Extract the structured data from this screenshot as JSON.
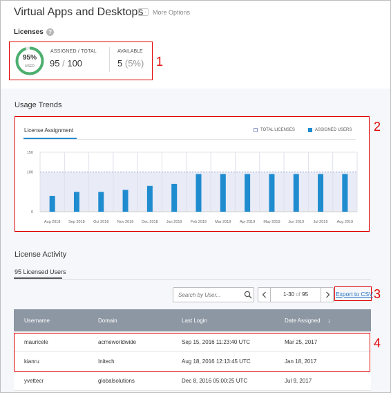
{
  "page": {
    "title": "Virtual Apps and Desktops",
    "more_options": "More Options"
  },
  "licenses": {
    "label": "Licenses",
    "help_icon": "?",
    "percent_used": 95,
    "percent_label": "95%",
    "used_label": "USED",
    "assigned_total_label": "ASSIGNED / TOTAL",
    "assigned": "95",
    "sep": "/",
    "total": "100",
    "available_label": "AVAILABLE",
    "available": "5",
    "available_pct": "(5%)"
  },
  "annotations": {
    "a1": "1",
    "a2": "2",
    "a3": "3",
    "a4": "4",
    "color": "#e00000"
  },
  "usage_trends": {
    "title": "Usage Trends",
    "tab": "License Assignment",
    "legend_total": "TOTAL LICENSES",
    "legend_assigned": "ASSIGNED USERS"
  },
  "chart_data": {
    "type": "bar",
    "title": "",
    "categories": [
      "Aug 2018",
      "Sep 2018",
      "Oct 2018",
      "Nov 2018",
      "Dec 2018",
      "Jan 2019",
      "Feb 2019",
      "Mar 2019",
      "Apr 2019",
      "May 2019",
      "Jun 2019",
      "Jul 2019",
      "Aug 2019"
    ],
    "series": [
      {
        "name": "ASSIGNED USERS",
        "values": [
          40,
          50,
          50,
          55,
          65,
          70,
          95,
          95,
          95,
          95,
          95,
          95,
          95
        ],
        "color": "#1f8ccf"
      },
      {
        "name": "TOTAL LICENSES",
        "values": [
          100,
          100,
          100,
          100,
          100,
          100,
          100,
          100,
          100,
          100,
          100,
          100,
          100
        ],
        "color": "#8e9ccf"
      }
    ],
    "ylim": [
      0,
      150
    ],
    "yticks": [
      "150",
      "100",
      "0"
    ],
    "ytick_values": [
      150,
      100,
      0
    ],
    "grid": true,
    "legend": "top-right"
  },
  "license_activity": {
    "title": "License Activity",
    "tab": "95 Licensed Users",
    "search_placeholder": "Search by User...",
    "pager_range": "1-30",
    "pager_of": "of",
    "pager_total": "95",
    "export_label": "Export to CSV",
    "columns": [
      "Username",
      "Domain",
      "Last Login",
      "Date Assigned"
    ],
    "sort_indicator": "↓",
    "rows": [
      {
        "username": "mauricele",
        "domain": "acmeworldwide",
        "last_login": "Sep 15, 2016 11:23:40 UTC",
        "date_assigned": "Mar 25, 2017"
      },
      {
        "username": "kianru",
        "domain": "Initech",
        "last_login": "Aug 18, 2016 12:13:45 UTC",
        "date_assigned": "Jan 18, 2017"
      },
      {
        "username": "yvettecr",
        "domain": "globalsolutions",
        "last_login": "Dec 8, 2016 05:00:25 UTC",
        "date_assigned": "Jul 9, 2017"
      }
    ]
  },
  "colors": {
    "accent": "#1f8ccf",
    "donut_green": "#4caf6e",
    "table_header": "#8d96a3",
    "chart_band": "#e9ebf6"
  }
}
